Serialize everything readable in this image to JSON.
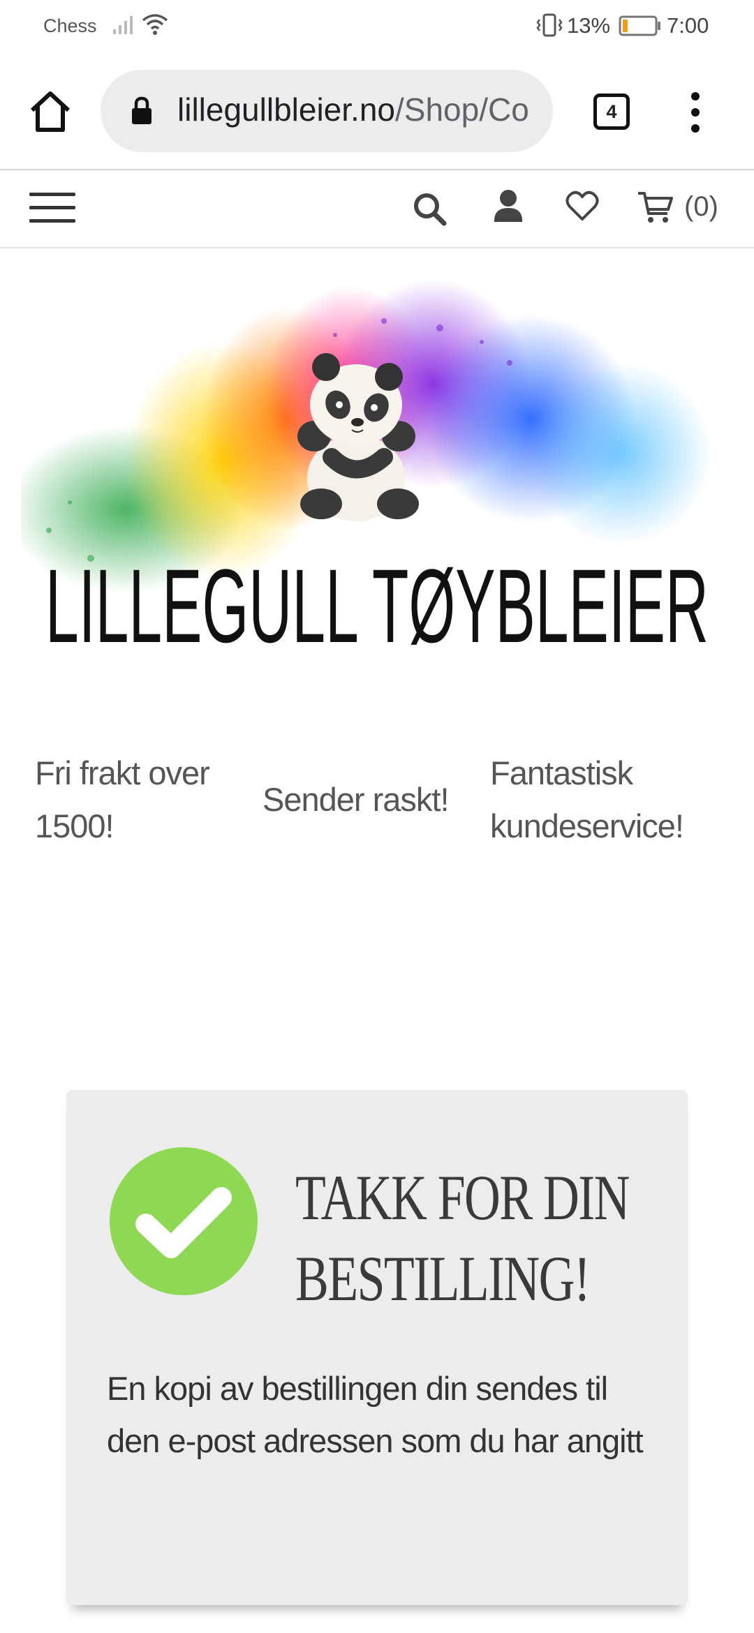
{
  "status_bar": {
    "carrier": "Chess",
    "battery_percent": "13%",
    "battery_level": 0.13,
    "time": "7:00",
    "icons": [
      "signal-icon",
      "wifi-icon",
      "vibrate-icon",
      "battery-icon"
    ]
  },
  "browser": {
    "url_host": "lillegullbleier.no",
    "url_path": "/Shop/Co",
    "tab_count": "4"
  },
  "site_header": {
    "cart_count": "(0)",
    "icons": [
      "menu-icon",
      "search-icon",
      "user-icon",
      "heart-icon",
      "cart-icon"
    ]
  },
  "logo": {
    "text": "LILLEGULL TØYBLEIER"
  },
  "usps": [
    "Fri frakt over 1500!",
    "Sender raskt!",
    "Fantastisk kundeservice!"
  ],
  "confirmation": {
    "title_line1": "TAKK FOR DIN",
    "title_line2": "BESTILLING!",
    "message": "En kopi av bestillingen din sendes til den e-post adressen som du har angitt",
    "icon": "checkmark-icon",
    "icon_color": "#8fd853"
  }
}
